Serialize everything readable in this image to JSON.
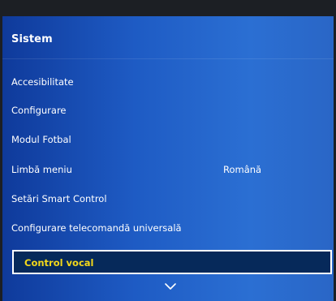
{
  "menu": {
    "title": "Sistem",
    "items": [
      {
        "label": "Accesibilitate",
        "value": ""
      },
      {
        "label": "Configurare",
        "value": ""
      },
      {
        "label": "Modul Fotbal",
        "value": ""
      },
      {
        "label": "Limbă meniu",
        "value": "Română"
      },
      {
        "label": "Setări Smart Control",
        "value": ""
      },
      {
        "label": "Configurare telecomandă universală",
        "value": ""
      },
      {
        "label": "Control vocal",
        "value": ""
      }
    ],
    "selected_index": 6,
    "more_indicator_icon": "chevron-down-icon"
  },
  "colors": {
    "background": "#1c1f24",
    "panel_blue": "#1e5bc4",
    "selected_bg": "#06295a",
    "selected_text": "#f3d81a",
    "text": "#ffffff"
  }
}
